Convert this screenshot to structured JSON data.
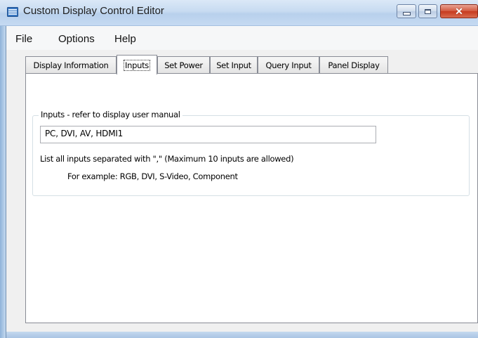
{
  "window": {
    "title": "Custom Display Control Editor",
    "icon": "app-window-icon",
    "accent_color": "#b8d0ec"
  },
  "menu": {
    "items": [
      "File",
      "Options",
      "Help"
    ]
  },
  "tabs": [
    {
      "label": "Display Information",
      "active": false
    },
    {
      "label": "Inputs",
      "active": true
    },
    {
      "label": "Set Power",
      "active": false
    },
    {
      "label": "Set Input",
      "active": false
    },
    {
      "label": "Query Input",
      "active": false
    },
    {
      "label": "Panel Display",
      "active": false
    }
  ],
  "inputs_group": {
    "legend": "Inputs - refer to display user manual",
    "field_value": "PC, DVI, AV, HDMI1",
    "help_line1": "List all inputs separated with \",\" (Maximum 10 inputs are allowed)",
    "help_line2": "For example: RGB, DVI, S-Video, Component"
  }
}
